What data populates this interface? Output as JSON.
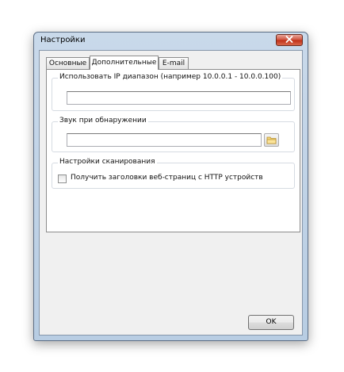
{
  "window": {
    "title": "Настройки",
    "close_icon": "close-icon"
  },
  "tabs": [
    {
      "label": "Основные",
      "active": false
    },
    {
      "label": "Дополнительные",
      "active": true
    },
    {
      "label": "E-mail",
      "active": false
    }
  ],
  "ip_range": {
    "label": "Использовать IP диапазон (например 10.0.0.1 - 10.0.0.100)",
    "value": ""
  },
  "sound": {
    "label": "Звук при обнаружении",
    "value": "",
    "browse_icon": "folder-icon"
  },
  "scan_settings": {
    "label": "Настройки сканирования",
    "http_headers_label": "Получить заголовки веб-страниц с HTTP устройств",
    "http_headers_checked": false
  },
  "buttons": {
    "ok_label": "OK"
  },
  "colors": {
    "close_button": "#c8412a",
    "frame": "#b8cde3"
  }
}
